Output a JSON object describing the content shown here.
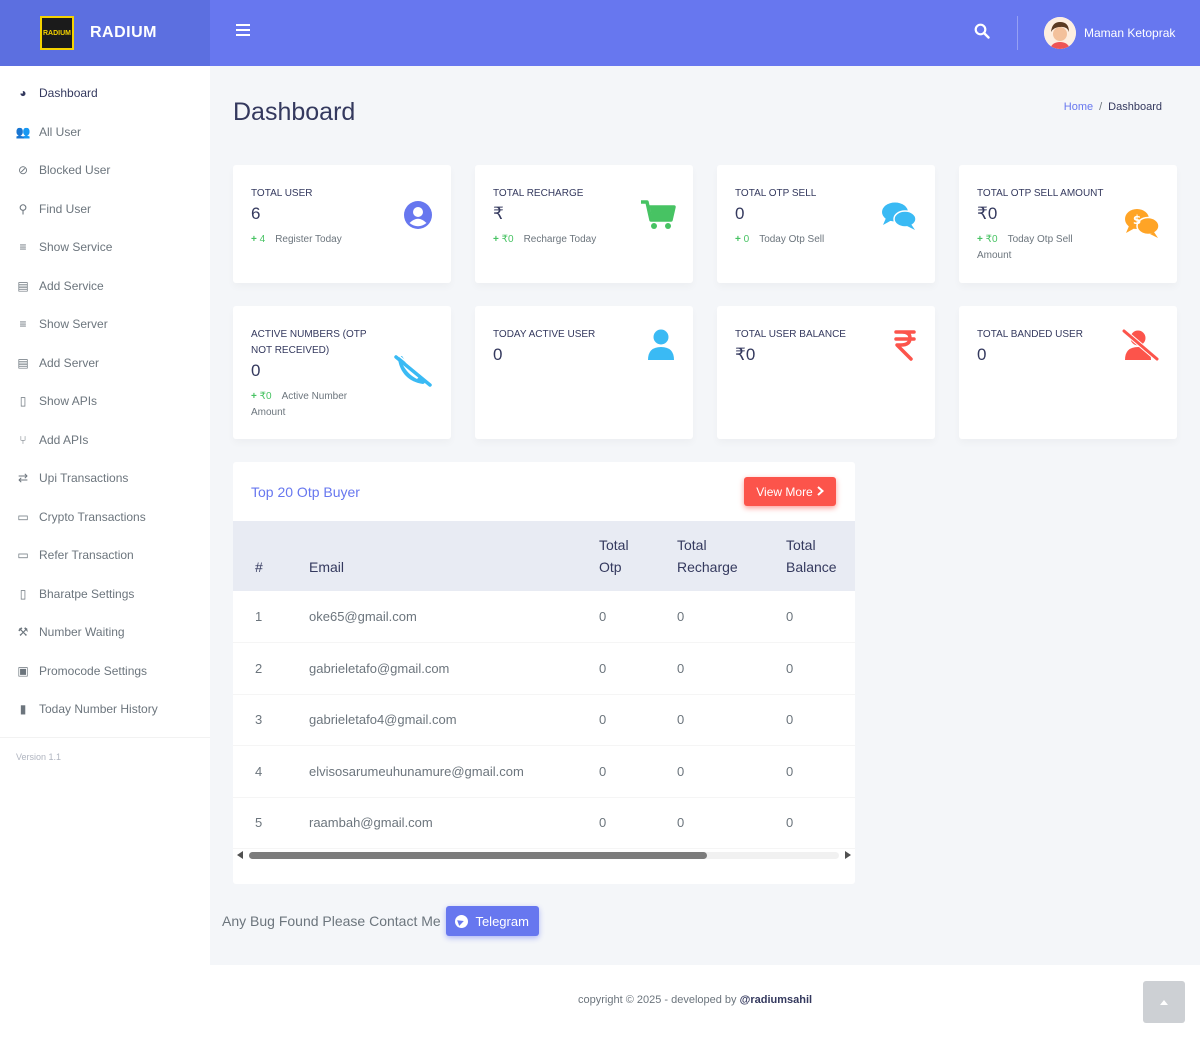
{
  "brand": {
    "name": "RADIUM",
    "logo_text": "RADIUM"
  },
  "header": {
    "user_name": "Maman Ketoprak"
  },
  "sidebar": {
    "items": [
      {
        "label": "Dashboard",
        "icon": "dashboard-icon"
      },
      {
        "label": "All User",
        "icon": "users-icon"
      },
      {
        "label": "Blocked User",
        "icon": "user-block-icon"
      },
      {
        "label": "Find User",
        "icon": "user-search-icon"
      },
      {
        "label": "Show Service",
        "icon": "list-icon"
      },
      {
        "label": "Add Service",
        "icon": "folder-plus-icon"
      },
      {
        "label": "Show Server",
        "icon": "list-icon"
      },
      {
        "label": "Add Server",
        "icon": "folder-plus-icon"
      },
      {
        "label": "Show APIs",
        "icon": "file-icon"
      },
      {
        "label": "Add APIs",
        "icon": "branch-icon"
      },
      {
        "label": "Upi Transactions",
        "icon": "exchange-icon"
      },
      {
        "label": "Crypto Transactions",
        "icon": "card-icon"
      },
      {
        "label": "Refer Transaction",
        "icon": "card-icon"
      },
      {
        "label": "Bharatpe Settings",
        "icon": "file-icon"
      },
      {
        "label": "Number Waiting",
        "icon": "wrench-icon"
      },
      {
        "label": "Promocode Settings",
        "icon": "gift-icon"
      },
      {
        "label": "Today Number History",
        "icon": "book-icon"
      }
    ],
    "version": "Version 1.1"
  },
  "page": {
    "title": "Dashboard"
  },
  "breadcrumb": {
    "home": "Home",
    "separator": "/",
    "current": "Dashboard"
  },
  "stats": {
    "total_user": {
      "title": "TOTAL USER",
      "value": "6",
      "delta": "4",
      "note": "Register Today"
    },
    "total_recharge": {
      "title": "TOTAL RECHARGE",
      "value": "₹",
      "delta": "₹0",
      "note": "Recharge Today"
    },
    "total_otp_sell": {
      "title": "TOTAL OTP SELL",
      "value": "0",
      "delta": "0",
      "note": "Today Otp Sell"
    },
    "total_otp_sell_amount": {
      "title": "TOTAL OTP SELL AMOUNT",
      "value": "₹0",
      "delta": "₹0",
      "note": "Today Otp Sell Amount"
    },
    "active_numbers": {
      "title": "ACTIVE NUMBERS (OTP NOT RECEIVED)",
      "value": "0",
      "delta": "₹0",
      "note": "Active Number Amount"
    },
    "today_active_user": {
      "title": "TODAY ACTIVE USER",
      "value": "0"
    },
    "total_user_balance": {
      "title": "TOTAL USER BALANCE",
      "value": "₹0"
    },
    "total_banded_user": {
      "title": "TOTAL BANDED USER",
      "value": "0"
    }
  },
  "colors": {
    "primary": "#6777ef",
    "success": "#47c363",
    "info": "#3abaf4",
    "warning": "#ffa426",
    "danger": "#fc544b"
  },
  "top_buyers": {
    "title": "Top 20 Otp Buyer",
    "view_more": "View More",
    "columns": {
      "num": "#",
      "email": "Email",
      "total_otp_1": "Total",
      "total_otp_2": "Otp",
      "total_recharge_1": "Total",
      "total_recharge_2": "Recharge",
      "total_balance_1": "Total",
      "total_balance_2": "Balance"
    },
    "rows": [
      {
        "num": "1",
        "email": "oke65@gmail.com",
        "otp": "0",
        "recharge": "0",
        "balance": "0"
      },
      {
        "num": "2",
        "email": "gabrieletafo@gmail.com",
        "otp": "0",
        "recharge": "0",
        "balance": "0"
      },
      {
        "num": "3",
        "email": "gabrieletafo4@gmail.com",
        "otp": "0",
        "recharge": "0",
        "balance": "0"
      },
      {
        "num": "4",
        "email": "elvisosarumeuhunamure@gmail.com",
        "otp": "0",
        "recharge": "0",
        "balance": "0"
      },
      {
        "num": "5",
        "email": "raambah@gmail.com",
        "otp": "0",
        "recharge": "0",
        "balance": "0"
      }
    ]
  },
  "contact": {
    "text": "Any Bug Found Please Contact Me",
    "button": "Telegram"
  },
  "footer": {
    "text": "copyright © 2025 - developed by ",
    "handle": "@radiumsahil"
  }
}
